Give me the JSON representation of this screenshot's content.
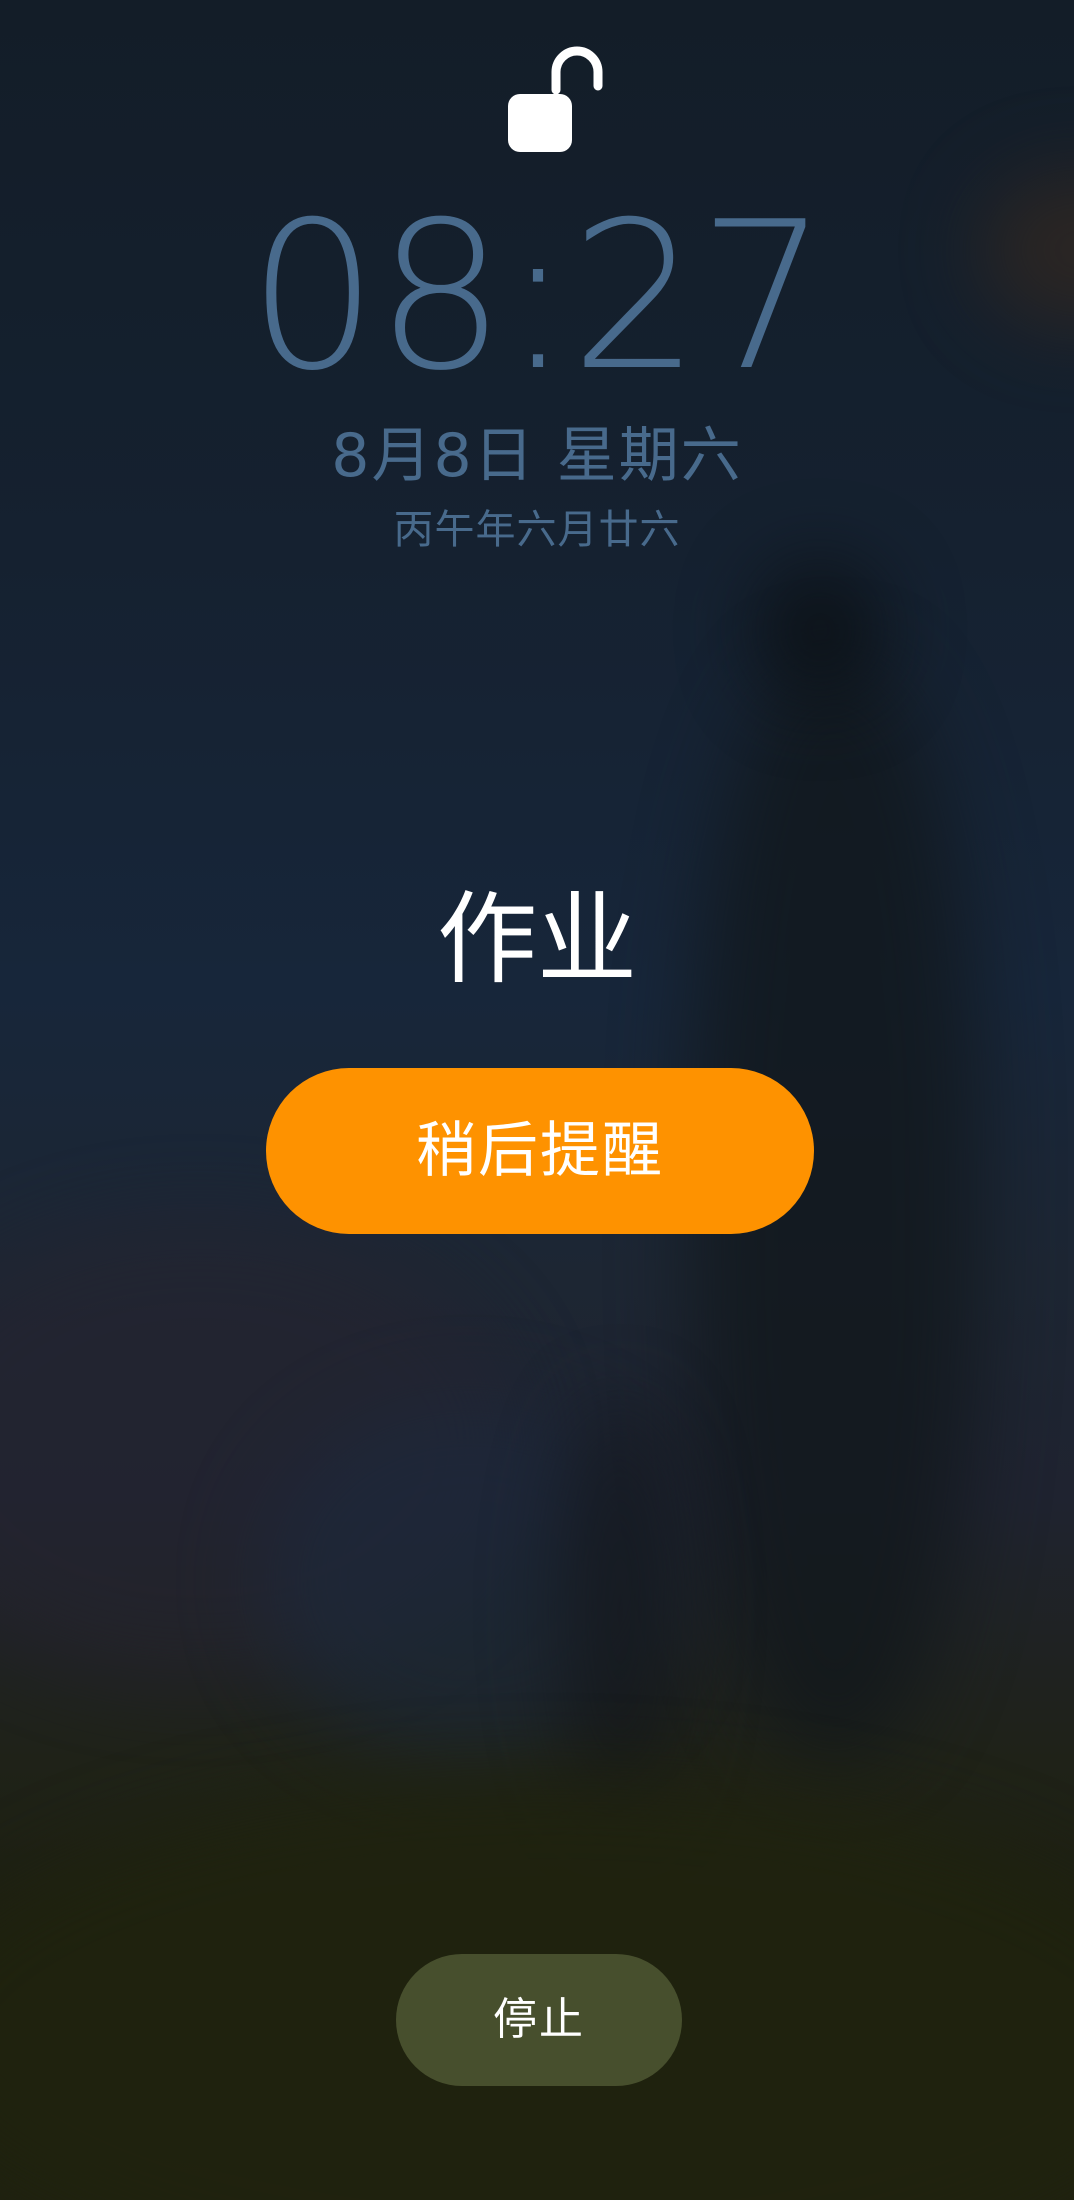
{
  "lock_screen": {
    "lock_icon": "unlocked-padlock-icon",
    "time": "08:27",
    "date": "8月8日 星期六",
    "lunar_date": "丙午年六月廿六"
  },
  "alarm": {
    "title": "作业",
    "snooze_label": "稍后提醒",
    "stop_label": "停止"
  },
  "colors": {
    "clock_text": "#486a8c",
    "snooze_button": "#fe9200",
    "stop_button": "#474f2d",
    "text_white": "#ffffff"
  }
}
